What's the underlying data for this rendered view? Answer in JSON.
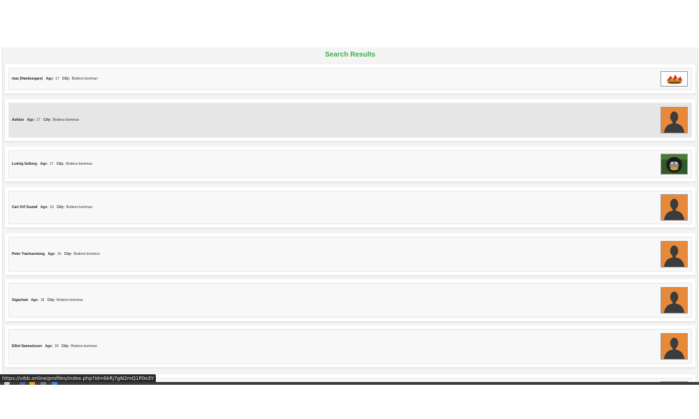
{
  "results": {
    "title": "Search Results",
    "age_label": "Age:",
    "city_label": "City:",
    "items": [
      {
        "name": "max (Hamburgare)",
        "age": "17",
        "city": "Bodens kommun",
        "avatar": "burger-avatar"
      },
      {
        "name": "Ashton",
        "age": "17",
        "city": "Bodens kommun",
        "avatar": "default-avatar"
      },
      {
        "name": "Ludvig Selberg",
        "age": "17",
        "city": "Bodens kommun",
        "avatar": "gorilla-avatar"
      },
      {
        "name": "Carl XVI Gustaf",
        "age": "16",
        "city": "Bodens kommun",
        "avatar": "default-avatar"
      },
      {
        "name": "Peter Trachuentong",
        "age": "16",
        "city": "Bodens kommun",
        "avatar": "default-avatar"
      },
      {
        "name": "Gigachad",
        "age": "18",
        "city": "Bodens kommun",
        "avatar": "default-avatar"
      },
      {
        "name": "Elliot Samuelsson",
        "age": "18",
        "city": "Bodens kommun",
        "avatar": "default-avatar"
      }
    ]
  },
  "status_bar": {
    "url": "https://vibb.online/profiles/index.php?id=6kRj7gN2mQ1P0o3Y"
  },
  "colors": {
    "title_green": "#3fae49",
    "avatar_orange": "#e8893a"
  }
}
